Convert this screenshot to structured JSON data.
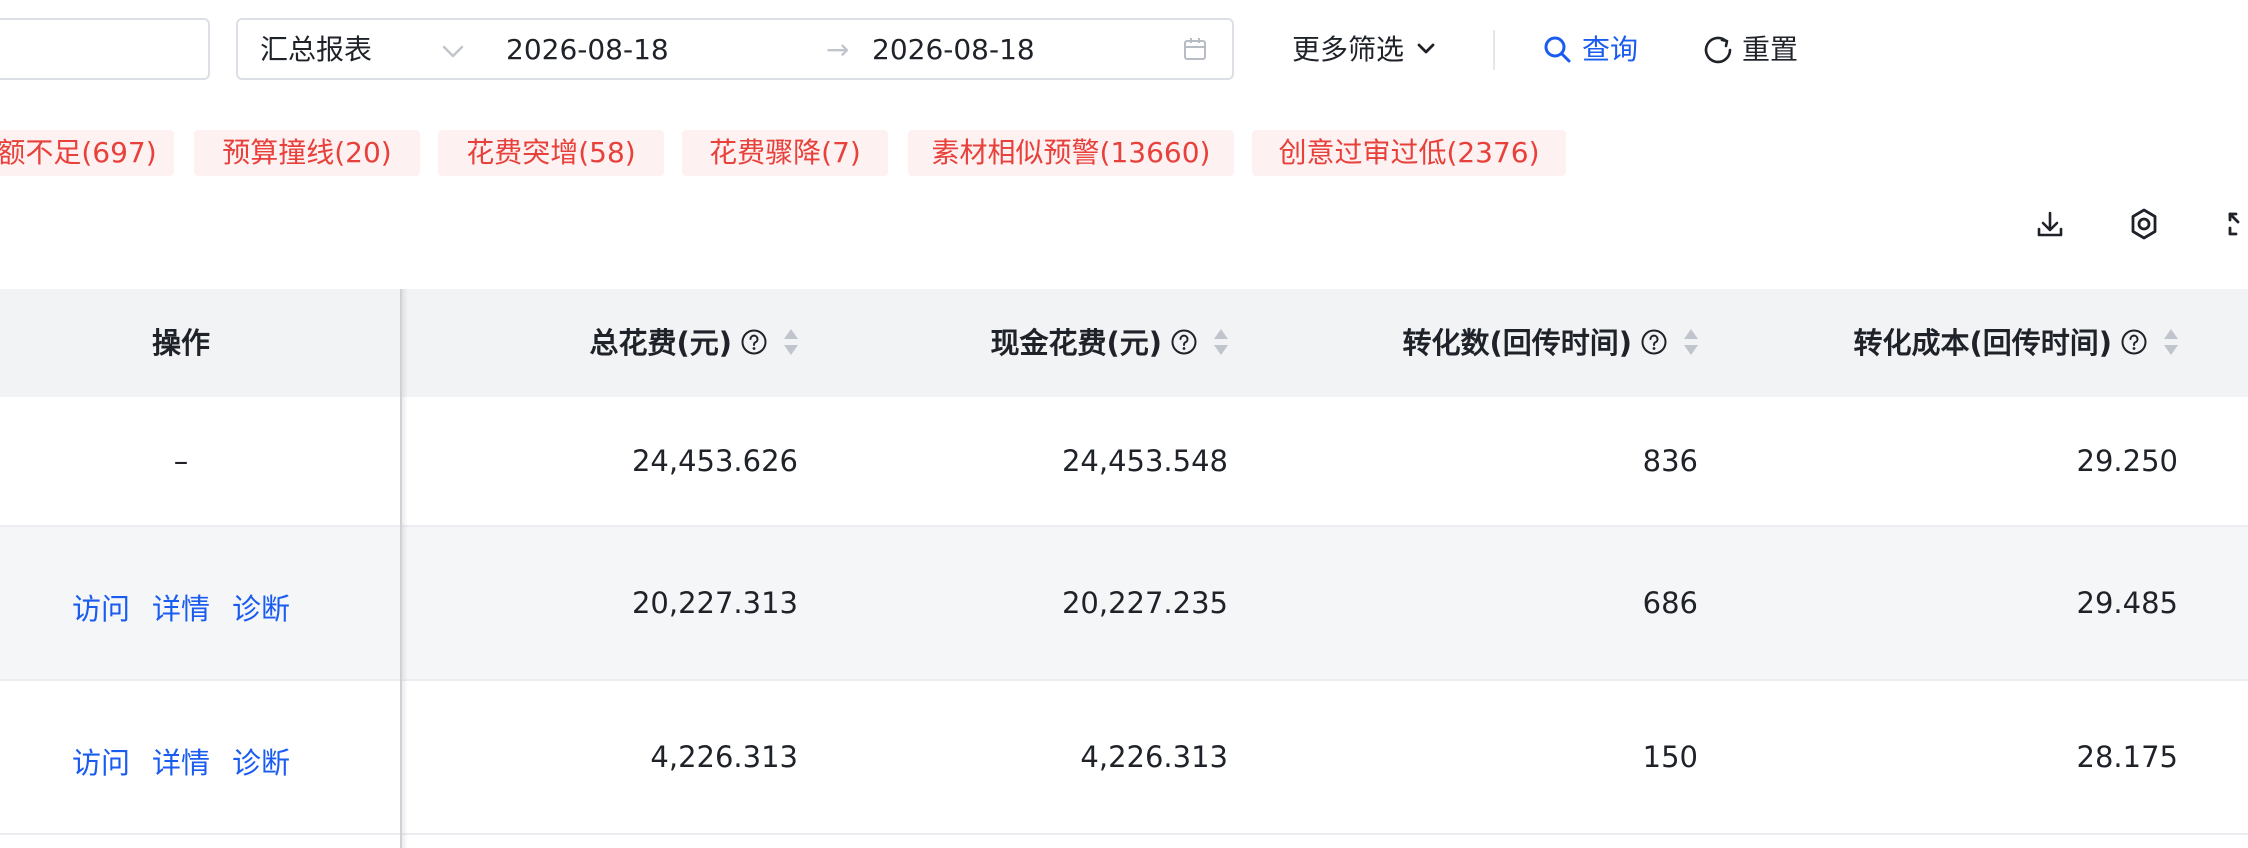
{
  "filter": {
    "report_type": "汇总报表",
    "date_start": "2026-08-18",
    "date_arrow": "→",
    "date_end": "2026-08-18",
    "more_filters": "更多筛选",
    "query_label": "查询",
    "reset_label": "重置"
  },
  "tags": [
    {
      "label": "额不足(697)"
    },
    {
      "label": "预算撞线(20)"
    },
    {
      "label": "花费突增(58)"
    },
    {
      "label": "花费骤降(7)"
    },
    {
      "label": "素材相似预警(13660)"
    },
    {
      "label": "创意过审过低(2376)"
    }
  ],
  "toolbar": {
    "download_icon": "download-icon",
    "settings_icon": "gear-icon",
    "fullscreen_icon": "fullscreen-icon"
  },
  "table": {
    "columns": {
      "op": "操作",
      "total_cost": "总花费(元)",
      "cash_cost": "现金花费(元)",
      "conversions": "转化数(回传时间)",
      "conversion_cost": "转化成本(回传时间)"
    },
    "rows": [
      {
        "op": "–",
        "total_cost": "24,453.626",
        "cash_cost": "24,453.548",
        "conversions": "836",
        "conversion_cost": "29.250"
      },
      {
        "op_links": [
          "访问",
          "详情",
          "诊断"
        ],
        "total_cost": "20,227.313",
        "cash_cost": "20,227.235",
        "conversions": "686",
        "conversion_cost": "29.485"
      },
      {
        "op_links": [
          "访问",
          "详情",
          "诊断"
        ],
        "total_cost": "4,226.313",
        "cash_cost": "4,226.313",
        "conversions": "150",
        "conversion_cost": "28.175"
      }
    ]
  },
  "colors": {
    "accent": "#1a5cf0",
    "tag_text": "#e8403a",
    "tag_bg": "#fdf1f1",
    "header_bg": "#f2f3f5",
    "stripe_bg": "#f5f6f8"
  }
}
